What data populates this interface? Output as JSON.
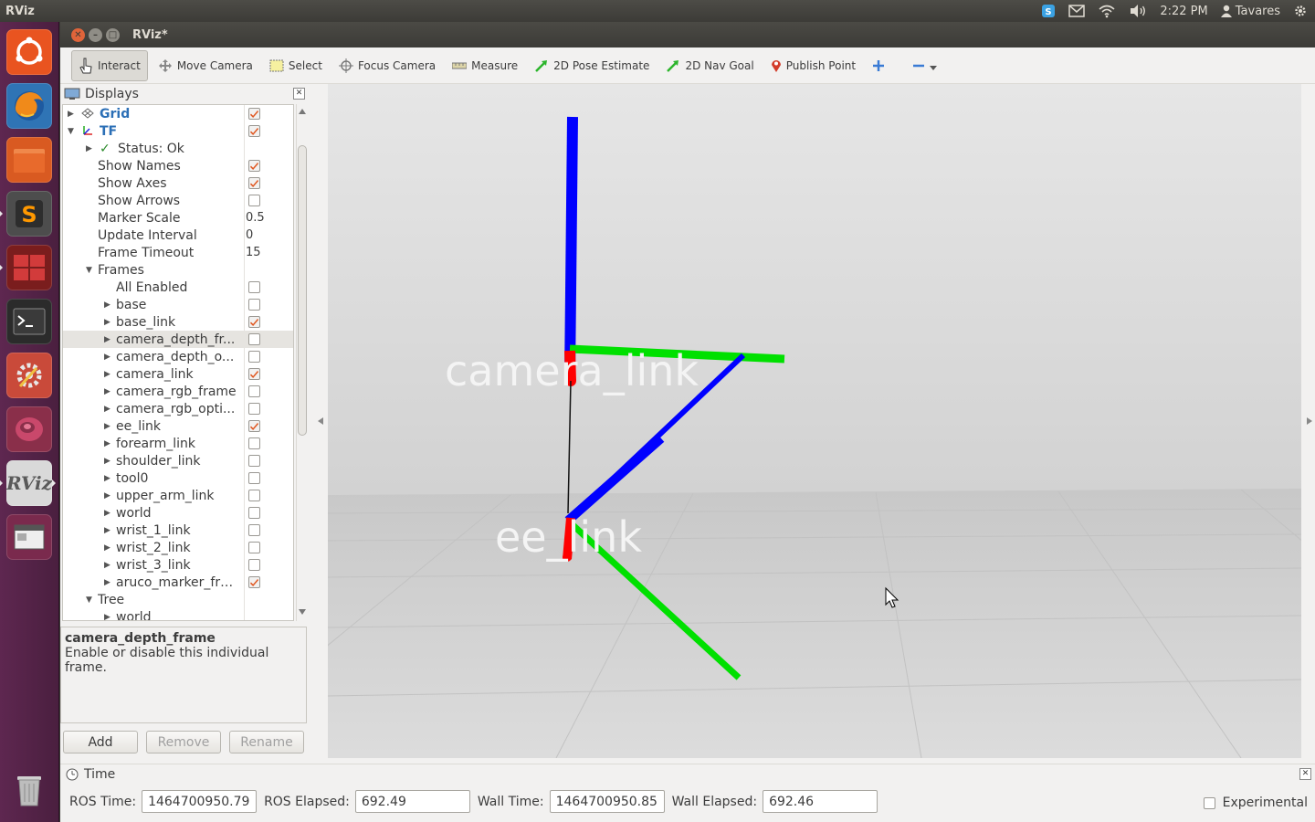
{
  "top_panel": {
    "app_name": "RViz",
    "clock": "2:22 PM",
    "user": "Tavares"
  },
  "launcher": {
    "items": [
      {
        "name": "ubuntu-dash-icon"
      },
      {
        "name": "firefox-icon"
      },
      {
        "name": "files-icon"
      },
      {
        "name": "sublime-text-icon"
      },
      {
        "name": "workspace-switcher-icon"
      },
      {
        "name": "terminal-icon"
      },
      {
        "name": "system-settings-icon"
      },
      {
        "name": "ros-icon"
      },
      {
        "name": "rviz-icon"
      },
      {
        "name": "window-icon"
      },
      {
        "name": "trash-icon"
      }
    ],
    "rviz_label": "RViz"
  },
  "window": {
    "title": "RViz*"
  },
  "toolbar": {
    "interact": "Interact",
    "move_camera": "Move Camera",
    "select": "Select",
    "focus_camera": "Focus Camera",
    "measure": "Measure",
    "pose_estimate": "2D Pose Estimate",
    "nav_goal": "2D Nav Goal",
    "publish_point": "Publish Point"
  },
  "displays": {
    "title": "Displays",
    "rows": [
      {
        "label": "Grid"
      },
      {
        "label": "TF"
      },
      {
        "label": "Status: Ok"
      },
      {
        "label": "Show Names"
      },
      {
        "label": "Show Axes"
      },
      {
        "label": "Show Arrows"
      },
      {
        "label": "Marker Scale",
        "value": "0.5"
      },
      {
        "label": "Update Interval",
        "value": "0"
      },
      {
        "label": "Frame Timeout",
        "value": "15"
      },
      {
        "label": "Frames"
      },
      {
        "label": "All Enabled"
      },
      {
        "label": "base"
      },
      {
        "label": "base_link"
      },
      {
        "label": "camera_depth_fr..."
      },
      {
        "label": "camera_depth_o..."
      },
      {
        "label": "camera_link"
      },
      {
        "label": "camera_rgb_frame"
      },
      {
        "label": "camera_rgb_opti..."
      },
      {
        "label": "ee_link"
      },
      {
        "label": "forearm_link"
      },
      {
        "label": "shoulder_link"
      },
      {
        "label": "tool0"
      },
      {
        "label": "upper_arm_link"
      },
      {
        "label": "world"
      },
      {
        "label": "wrist_1_link"
      },
      {
        "label": "wrist_2_link"
      },
      {
        "label": "wrist_3_link"
      },
      {
        "label": "aruco_marker_fra..."
      },
      {
        "label": "Tree"
      },
      {
        "label": "world"
      }
    ],
    "checked": {
      "grid": true,
      "tf": true,
      "show_names": true,
      "show_axes": true,
      "show_arrows": false,
      "all_enabled": false,
      "base": false,
      "base_link": true,
      "camera_depth_frame": false,
      "camera_depth_optical": false,
      "camera_link": true,
      "camera_rgb_frame": false,
      "camera_rgb_optical": false,
      "ee_link": true,
      "forearm_link": false,
      "shoulder_link": false,
      "tool0": false,
      "upper_arm_link": false,
      "world": false,
      "wrist_1_link": false,
      "wrist_2_link": false,
      "wrist_3_link": false,
      "aruco_marker_frame": true
    },
    "description_title": "camera_depth_frame",
    "description_text": "Enable or disable this individual frame.",
    "add": "Add",
    "remove": "Remove",
    "rename": "Rename"
  },
  "viewport": {
    "frame_labels": [
      "camera_link",
      "ee_link"
    ],
    "colors": {
      "x_axis": "#ff0000",
      "y_axis": "#00ff00",
      "z_axis": "#0000ff",
      "background": "#4a4a4a"
    }
  },
  "time_panel": {
    "title": "Time",
    "ros_time_label": "ROS Time:",
    "ros_time": "1464700950.79",
    "ros_elapsed_label": "ROS Elapsed:",
    "ros_elapsed": "692.49",
    "wall_time_label": "Wall Time:",
    "wall_time": "1464700950.85",
    "wall_elapsed_label": "Wall Elapsed:",
    "wall_elapsed": "692.46",
    "experimental": "Experimental"
  }
}
